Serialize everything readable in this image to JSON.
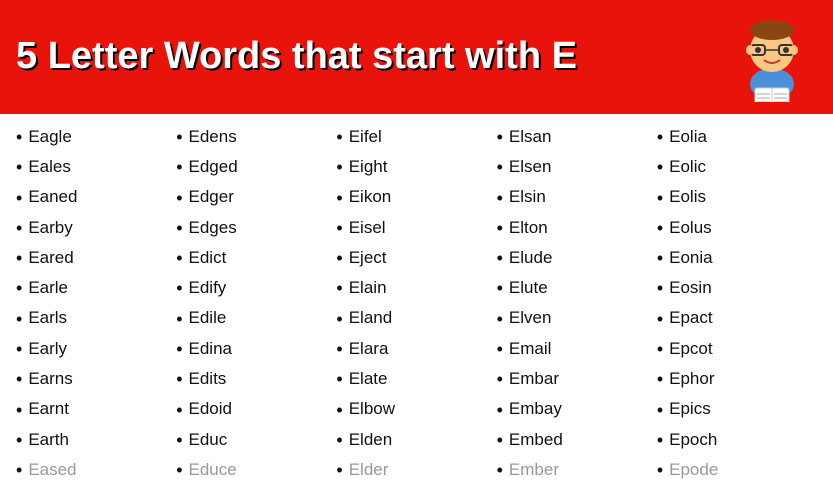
{
  "header": {
    "title_bold": "5 Letter Words",
    "title_normal": " that start with E"
  },
  "columns": [
    {
      "words": [
        "Eagle",
        "Eales",
        "Eaned",
        "Earby",
        "Eared",
        "Earle",
        "Earls",
        "Early",
        "Earns",
        "Earnt",
        "Earth",
        "Eased"
      ]
    },
    {
      "words": [
        "Edens",
        "Edged",
        "Edger",
        "Edges",
        "Edict",
        "Edify",
        "Edile",
        "Edina",
        "Edits",
        "Edoid",
        "Educ",
        "Educe"
      ]
    },
    {
      "words": [
        "Eifel",
        "Eight",
        "Eikon",
        "Eisel",
        "Eject",
        "Elain",
        "Eland",
        "Elara",
        "Elate",
        "Elbow",
        "Elden",
        "Elder"
      ]
    },
    {
      "words": [
        "Elsan",
        "Elsen",
        "Elsin",
        "Elton",
        "Elude",
        "Elute",
        "Elven",
        "Email",
        "Embar",
        "Embay",
        "Embed",
        "Ember"
      ]
    },
    {
      "words": [
        "Eolia",
        "Eolic",
        "Eolis",
        "Eolus",
        "Eonia",
        "Eosin",
        "Epact",
        "Epcot",
        "Ephor",
        "Epics",
        "Epoch",
        "Epode"
      ]
    }
  ]
}
